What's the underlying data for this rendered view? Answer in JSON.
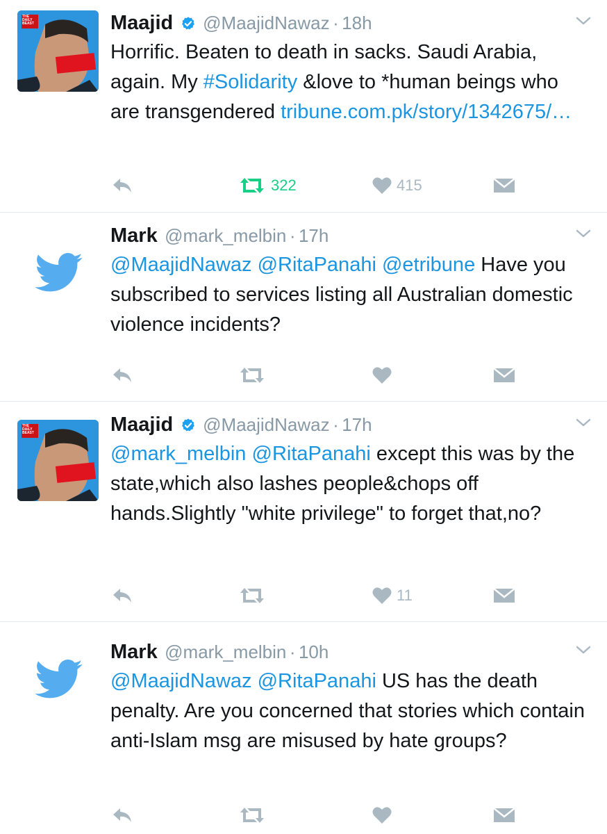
{
  "tweets": [
    {
      "author": "Maajid",
      "handle": "@MaajidNawaz",
      "dot": "·",
      "time": "18h",
      "avatar_text": "THE DAILY BEAST",
      "text": [
        "Horrific. Beaten to death in sacks. Saudi Arabia, again. My ",
        "#Solidarity",
        " &love to *human beings who are transgendered ",
        "tribune.com.pk/story/1342675/…"
      ],
      "retweet_count": "322",
      "like_count": "415"
    },
    {
      "author": "Mark",
      "handle": "@mark_melbin",
      "dot": "·",
      "time": "17h",
      "text": [
        "@MaajidNawaz",
        " ",
        "@RitaPanahi",
        " ",
        "@etribune",
        " Have you subscribed to services listing all Australian domestic violence incidents?"
      ]
    },
    {
      "author": "Maajid",
      "handle": "@MaajidNawaz",
      "dot": "·",
      "time": "17h",
      "avatar_text": "THE DAILY BEAST",
      "text": [
        "@mark_melbin",
        " ",
        "@RitaPanahi",
        " except this was by the state,which also lashes people&chops off hands.Slightly \"white privilege\" to forget that,no?"
      ],
      "like_count": "11"
    },
    {
      "author": "Mark",
      "handle": "@mark_melbin",
      "dot": "·",
      "time": "10h",
      "text": [
        "@MaajidNawaz",
        " ",
        "@RitaPanahi",
        " US has the death penalty. Are you concerned that stories which contain anti-Islam msg are misused by hate groups?"
      ]
    }
  ],
  "colors": {
    "link": "#1b95e0",
    "retweet_active": "#19cf86",
    "icon_gray": "#aab8c2",
    "verified": "#1da1f2",
    "bird": "#55acee"
  },
  "icons": {
    "reply": "reply-icon",
    "retweet": "retweet-icon",
    "like": "heart-icon",
    "dm": "envelope-icon",
    "menu": "chevron-down-icon",
    "verified": "verified-badge-icon",
    "bird": "twitter-bird-icon"
  }
}
